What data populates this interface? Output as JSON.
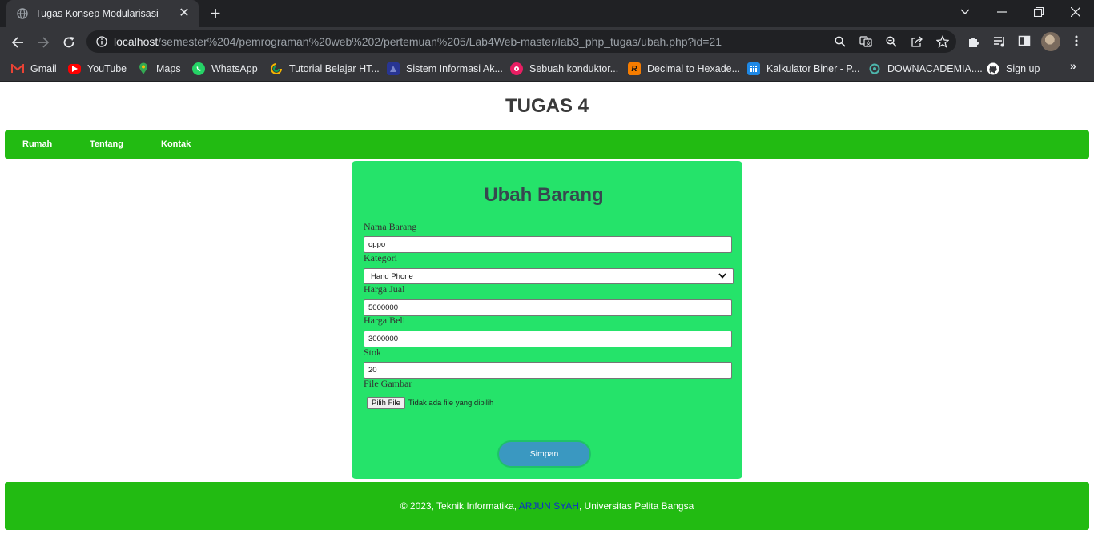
{
  "browser": {
    "tab": {
      "title": "Tugas Konsep Modularisasi"
    },
    "url": {
      "host": "localhost",
      "path": "/semester%204/pemrograman%20web%202/pertemuan%205/Lab4Web-master/lab3_php_tugas/ubah.php?id=21"
    },
    "bookmarks": [
      {
        "label": "Gmail",
        "icon": "gmail-icon",
        "color": "#ea4335"
      },
      {
        "label": "YouTube",
        "icon": "youtube-icon",
        "color": "#ff0000"
      },
      {
        "label": "Maps",
        "icon": "maps-icon",
        "color": "#34a853"
      },
      {
        "label": "WhatsApp",
        "icon": "whatsapp-icon",
        "color": "#25d366"
      },
      {
        "label": "Tutorial Belajar HT...",
        "icon": "tutorial-icon",
        "color": "#f4b400"
      },
      {
        "label": "Sistem Informasi Ak...",
        "icon": "academic-icon",
        "color": "#3949ab"
      },
      {
        "label": "Sebuah konduktor...",
        "icon": "conductor-icon",
        "color": "#c2185b"
      },
      {
        "label": "Decimal to Hexade...",
        "icon": "r-icon",
        "color": "#f57c00"
      },
      {
        "label": "Kalkulator Biner - P...",
        "icon": "calculator-icon",
        "color": "#1e88e5"
      },
      {
        "label": "DOWNACADEMIA....",
        "icon": "downacademia-icon",
        "color": "#4db6ac"
      },
      {
        "label": "Sign up",
        "icon": "github-icon",
        "color": "#ffffff"
      }
    ]
  },
  "page": {
    "title": "TUGAS 4",
    "nav": [
      "Rumah",
      "Tentang",
      "Kontak"
    ],
    "form": {
      "heading": "Ubah Barang",
      "nama_label": "Nama Barang",
      "nama_value": "oppo",
      "kategori_label": "Kategori",
      "kategori_value": "Hand Phone",
      "harga_jual_label": "Harga Jual",
      "harga_jual_value": "5000000",
      "harga_beli_label": "Harga Beli",
      "harga_beli_value": "3000000",
      "stok_label": "Stok",
      "stok_value": "20",
      "file_label": "File Gambar",
      "file_button": "Pilih File",
      "file_status": "Tidak ada file yang dipilih",
      "submit": "Simpan"
    },
    "footer": {
      "prefix": "© 2023, Teknik Informatika, ",
      "name": "ARJUN SYAH",
      "suffix": ", Universitas Pelita Bangsa"
    }
  },
  "colors": {
    "nav_green": "#22bb12",
    "card_green": "#25e36a",
    "button_blue": "#3a98c1"
  }
}
